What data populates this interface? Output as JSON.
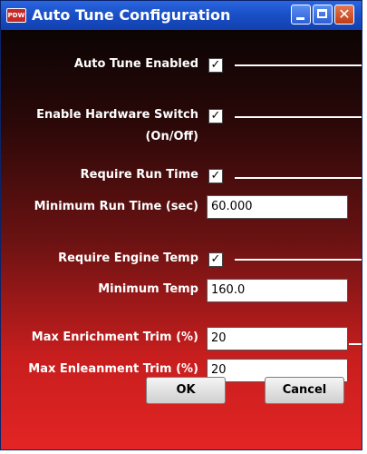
{
  "window": {
    "title": "Auto Tune Configuration",
    "app_icon_text": "PDW"
  },
  "titlebar_buttons": {
    "close_glyph": "✕"
  },
  "form": {
    "auto_tune_enabled": {
      "label": "Auto Tune Enabled",
      "checked": true
    },
    "enable_hardware_switch": {
      "label_line1": "Enable Hardware Switch",
      "label_line2": "(On/Off)",
      "checked": true
    },
    "require_run_time": {
      "label": "Require Run Time",
      "checked": true
    },
    "minimum_run_time": {
      "label": "Minimum Run Time (sec)",
      "value": "60.000"
    },
    "require_engine_temp": {
      "label": "Require Engine Temp",
      "checked": true
    },
    "minimum_temp": {
      "label": "Minimum Temp",
      "value": "160.0"
    },
    "max_enrichment_trim": {
      "label": "Max Enrichment Trim (%)",
      "value": "20"
    },
    "max_enleanment_trim": {
      "label": "Max Enleanment Trim (%)",
      "value": "20"
    }
  },
  "checkmark": "✓",
  "buttons": {
    "ok": "OK",
    "cancel": "Cancel"
  },
  "colors": {
    "titlebar": "#1a50c8",
    "background_top": "#0c0404",
    "background_bottom": "#e32424"
  }
}
